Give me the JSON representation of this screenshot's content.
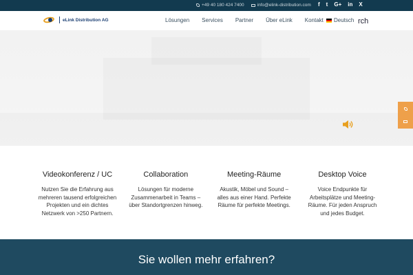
{
  "topbar": {
    "phone": "+49 40 180 424 7400",
    "email": "info@elink-distribution.com",
    "social": [
      "f",
      "t",
      "G+",
      "in",
      "X"
    ]
  },
  "nav": {
    "logo_text": "eLink Distribution AG",
    "menu": [
      "Lösungen",
      "Services",
      "Partner",
      "Über eLink",
      "Kontakt"
    ],
    "language": "Deutsch",
    "search_fragment": "rch"
  },
  "features": [
    {
      "title": "Videokonferenz / UC",
      "text": "Nutzen Sie die Erfahrung aus mehreren tausend erfolgreichen Projekten und ein dichtes Netzwerk von >250 Partnern."
    },
    {
      "title": "Collaboration",
      "text": "Lösungen für moderne Zusammenarbeit in Teams – über Standortgrenzen hinweg."
    },
    {
      "title": "Meeting-Räume",
      "text": "Akustik, Möbel und Sound – alles aus einer Hand. Perfekte Räume für perfekte Meetings."
    },
    {
      "title": "Desktop Voice",
      "text": "Voice Endpunkte für Arbeitsplätze und Meeting-Räume. Für jeden Anspruch und jedes Budget."
    }
  ],
  "cta": {
    "heading": "Sie wollen mehr erfahren?"
  },
  "colors": {
    "topbar": "#123a4f",
    "band": "#1f4a60",
    "side_buttons": "#eea04a",
    "speaker": "#e8a020"
  },
  "icons": [
    "phone-icon",
    "mail-icon",
    "speaker-icon",
    "flag-de-icon"
  ]
}
